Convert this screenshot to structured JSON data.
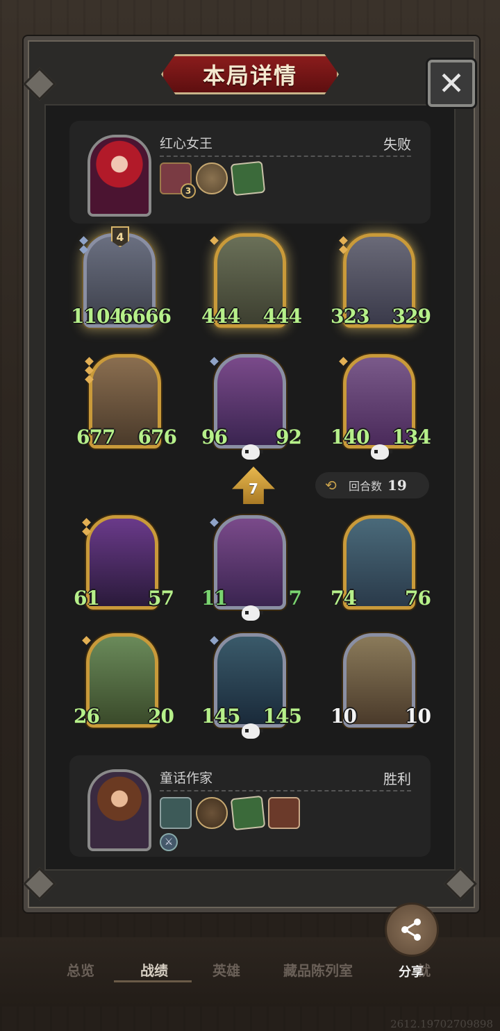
{
  "title": "本局详情",
  "close_label": "✕",
  "top_player": {
    "name": "红心女王",
    "result": "失败",
    "hero_level": "3"
  },
  "bottom_player": {
    "name": "童话作家",
    "result": "胜利"
  },
  "top_board": [
    {
      "tier": "4",
      "attack": "1104",
      "health": "6666"
    },
    {
      "attack": "444",
      "health": "444"
    },
    {
      "attack": "323",
      "health": "329"
    },
    {
      "attack": "677",
      "health": "676"
    },
    {
      "attack": "96",
      "health": "92"
    },
    {
      "attack": "140",
      "health": "134"
    }
  ],
  "bottom_board": [
    {
      "attack": "61",
      "health": "57"
    },
    {
      "attack": "11",
      "health": "7"
    },
    {
      "attack": "74",
      "health": "76"
    },
    {
      "attack": "26",
      "health": "20"
    },
    {
      "attack": "145",
      "health": "145"
    },
    {
      "attack": "10",
      "health": "10"
    }
  ],
  "level_arrow": "7",
  "round": {
    "label": "回合数",
    "value": "19"
  },
  "nav": {
    "tabs": [
      "总览",
      "战绩",
      "英雄",
      "藏品陈列室",
      "就"
    ],
    "share_label": "分享"
  },
  "uid": "2612.19702709898"
}
